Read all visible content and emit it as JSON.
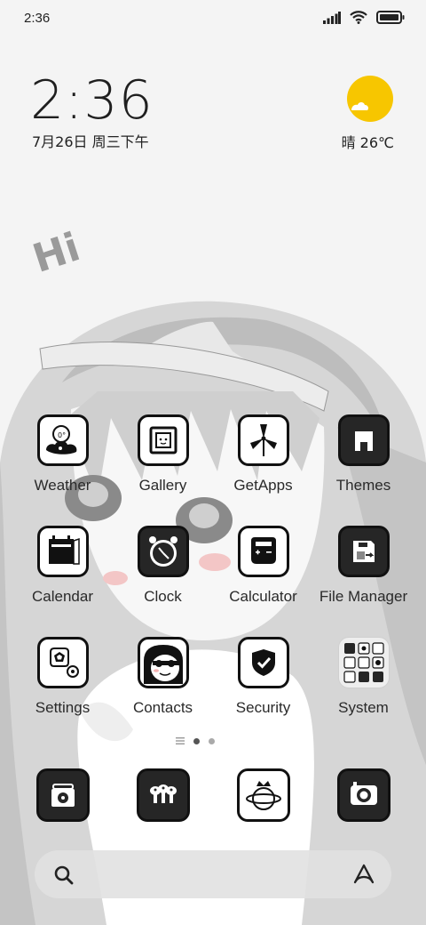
{
  "status_bar": {
    "time": "2:36",
    "icons": [
      "signal-icon",
      "wifi-icon",
      "battery-icon"
    ]
  },
  "clock_widget": {
    "time": "2:36",
    "date": "7月26日 周三下午"
  },
  "weather_widget": {
    "icon": "sun-cloud-icon",
    "text": "晴 26℃"
  },
  "wallpaper": {
    "text": "Hi"
  },
  "apps": [
    {
      "label": "Weather",
      "icon": "weather-icon"
    },
    {
      "label": "Gallery",
      "icon": "gallery-icon"
    },
    {
      "label": "GetApps",
      "icon": "getapps-icon"
    },
    {
      "label": "Themes",
      "icon": "themes-icon"
    },
    {
      "label": "Calendar",
      "icon": "calendar-icon"
    },
    {
      "label": "Clock",
      "icon": "clock-icon"
    },
    {
      "label": "Calculator",
      "icon": "calculator-icon"
    },
    {
      "label": "File Manager",
      "icon": "file-manager-icon"
    },
    {
      "label": "Settings",
      "icon": "settings-icon"
    },
    {
      "label": "Contacts",
      "icon": "contacts-icon"
    },
    {
      "label": "Security",
      "icon": "security-icon"
    },
    {
      "label": "System",
      "icon": "system-folder-icon"
    }
  ],
  "page_indicator": {
    "pages": 2,
    "current": 1
  },
  "dock": [
    {
      "icon": "phone-icon"
    },
    {
      "icon": "messages-icon"
    },
    {
      "icon": "browser-icon"
    },
    {
      "icon": "camera-icon"
    }
  ],
  "search_bar": {
    "left_icon": "search-icon",
    "right_icon": "assistant-icon"
  },
  "colors": {
    "sun": "#f7c600",
    "icon_dark": "#262626",
    "background": "#f4f4f4"
  }
}
